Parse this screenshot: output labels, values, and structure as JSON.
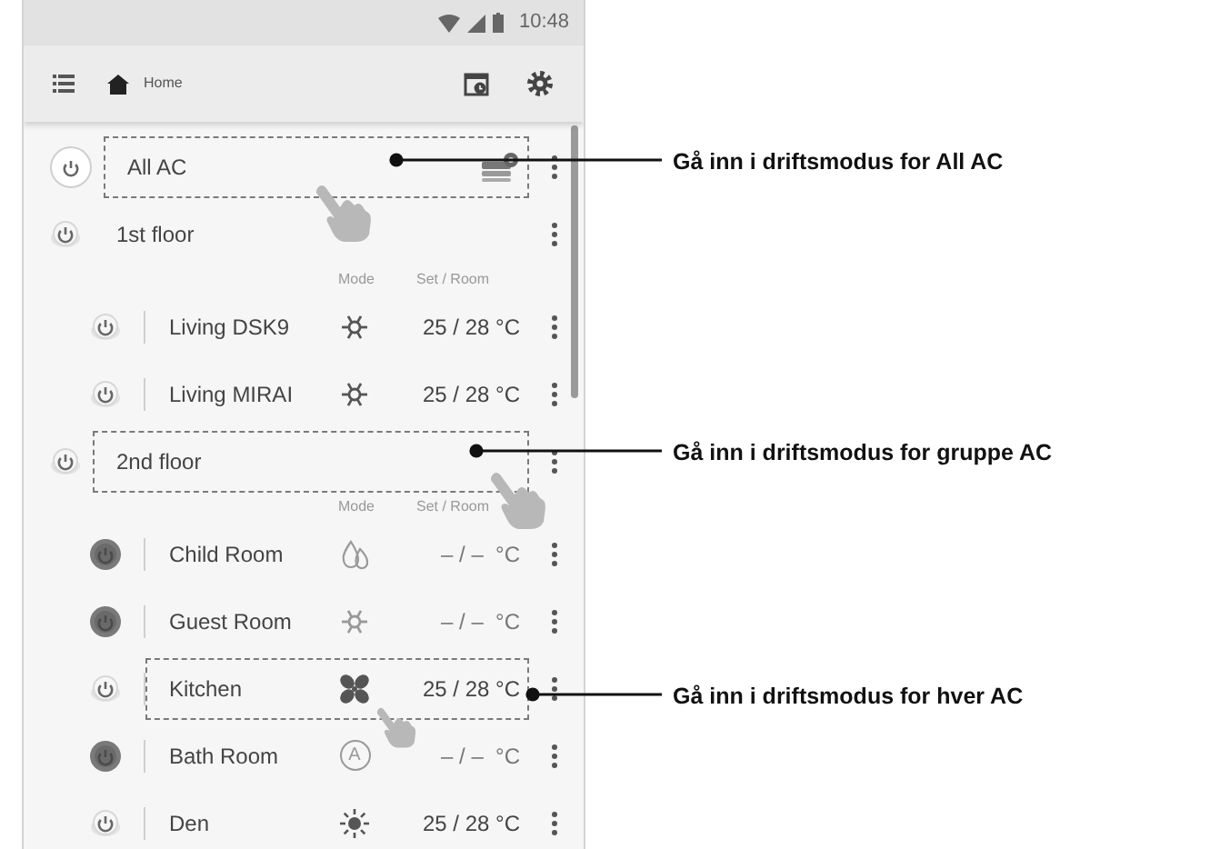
{
  "status_bar": {
    "time": "10:48"
  },
  "toolbar": {
    "title": "Home"
  },
  "list": [
    {
      "kind": "all",
      "name": "All AC",
      "power_on": true,
      "highlighted": true
    },
    {
      "kind": "group",
      "name": "1st floor",
      "power_on": true,
      "highlighted": false,
      "column_headers": {
        "mode": "Mode",
        "temps": "Set / Room"
      },
      "children": [
        {
          "name": "Living DSK9",
          "power_on": true,
          "kind": "cool",
          "temps": "25 / 28 °C",
          "highlighted": false
        },
        {
          "name": "Living MIRAI",
          "power_on": true,
          "kind": "cool",
          "temps": "25 / 28 °C",
          "highlighted": false
        }
      ]
    },
    {
      "kind": "group",
      "name": "2nd floor",
      "power_on": true,
      "highlighted": true,
      "column_headers": {
        "mode": "Mode",
        "temps": "Set / Room"
      },
      "children": [
        {
          "name": "Child Room",
          "power_on": false,
          "kind": "dry",
          "temps": "– / –  °C",
          "highlighted": false
        },
        {
          "name": "Guest Room",
          "power_on": false,
          "kind": "cool",
          "temps": "– / –  °C",
          "highlighted": false
        },
        {
          "name": "Kitchen",
          "power_on": true,
          "kind": "fan",
          "temps": "25 / 28 °C",
          "highlighted": true
        },
        {
          "name": "Bath Room",
          "power_on": false,
          "kind": "auto",
          "mode_label": "A",
          "temps": "– / –  °C",
          "highlighted": false
        },
        {
          "name": "Den",
          "power_on": true,
          "kind": "heat",
          "temps": "25 / 28 °C",
          "highlighted": false
        }
      ]
    }
  ],
  "callouts": [
    {
      "text": "Gå inn i driftsmodus for All AC"
    },
    {
      "text": "Gå inn i driftsmodus for gruppe AC"
    },
    {
      "text": "Gå inn i driftsmodus for hver AC"
    }
  ]
}
